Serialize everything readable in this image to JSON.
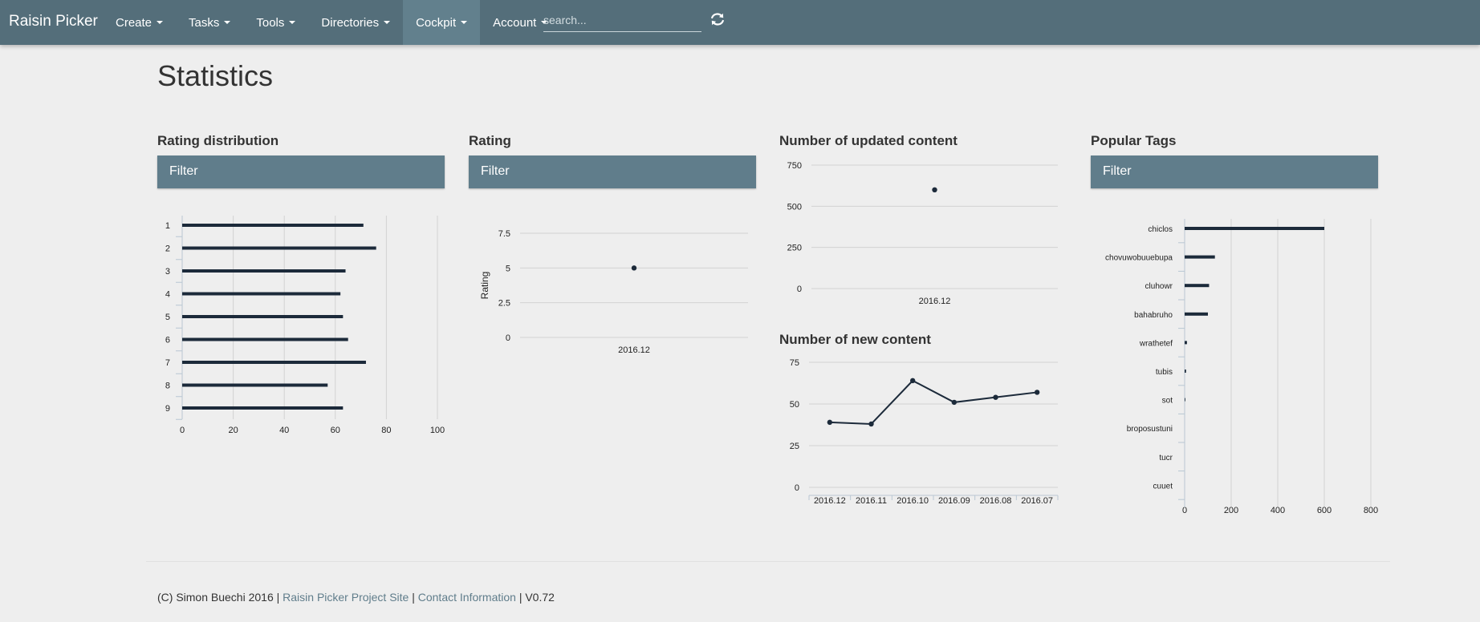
{
  "nav": {
    "brand": "Raisin Picker",
    "items": [
      {
        "label": "Create"
      },
      {
        "label": "Tasks"
      },
      {
        "label": "Tools"
      },
      {
        "label": "Directories"
      },
      {
        "label": "Cockpit"
      },
      {
        "label": "Account"
      }
    ],
    "active_item": "Cockpit",
    "search_placeholder": "search..."
  },
  "page": {
    "title": "Statistics"
  },
  "sections": {
    "rating_distribution": {
      "title": "Rating distribution",
      "filter_label": "Filter"
    },
    "rating": {
      "title": "Rating",
      "filter_label": "Filter"
    },
    "updated_content": {
      "title": "Number of updated content"
    },
    "new_content": {
      "title": "Number of new content"
    },
    "popular_tags": {
      "title": "Popular Tags",
      "filter_label": "Filter"
    }
  },
  "chart_data": [
    {
      "id": "rating_distribution",
      "type": "bar",
      "orientation": "horizontal",
      "categories": [
        "1",
        "2",
        "3",
        "4",
        "5",
        "6",
        "7",
        "8",
        "9"
      ],
      "values": [
        71,
        76,
        64,
        62,
        63,
        65,
        72,
        57,
        63
      ],
      "xlim": [
        0,
        100
      ],
      "xticks": [
        "0",
        "20",
        "40",
        "60",
        "80",
        "100"
      ],
      "grid": true,
      "color": "#1c2a3a"
    },
    {
      "id": "rating",
      "type": "scatter",
      "x": [
        "2016.12"
      ],
      "values": [
        5
      ],
      "ylabel": "Rating",
      "ylim": [
        0,
        7.5
      ],
      "yticks": [
        "0",
        "2.5",
        "5",
        "7.5"
      ],
      "grid": true,
      "color": "#1c2a3a"
    },
    {
      "id": "updated_content",
      "type": "scatter",
      "x": [
        "2016.12"
      ],
      "values": [
        600
      ],
      "ylim": [
        0,
        750
      ],
      "yticks": [
        "0",
        "250",
        "500",
        "750"
      ],
      "grid": true,
      "color": "#1c2a3a"
    },
    {
      "id": "new_content",
      "type": "line",
      "x": [
        "2016.12",
        "2016.11",
        "2016.10",
        "2016.09",
        "2016.08",
        "2016.07"
      ],
      "values": [
        39,
        38,
        64,
        51,
        54,
        57
      ],
      "ylim": [
        0,
        75
      ],
      "yticks": [
        "0",
        "25",
        "50",
        "75"
      ],
      "grid": true,
      "color": "#1c2a3a"
    },
    {
      "id": "popular_tags",
      "type": "bar",
      "orientation": "horizontal",
      "categories": [
        "chiclos",
        "chovuwobuuebupa",
        "cluhowr",
        "bahabruho",
        "wrathetef",
        "tubis",
        "sot",
        "broposustuni",
        "tucr",
        "cuuet"
      ],
      "values": [
        600,
        130,
        105,
        100,
        10,
        6,
        3,
        0,
        0,
        0
      ],
      "xlim": [
        0,
        800
      ],
      "xticks": [
        "0",
        "200",
        "400",
        "600",
        "800"
      ],
      "grid": true,
      "color": "#1c2a3a"
    }
  ],
  "footer": {
    "copyright": "(C) Simon Buechi 2016 |",
    "project_link": "Raisin Picker Project Site",
    "sep1": "|",
    "contact_link": "Contact Information",
    "version": "| V0.72"
  },
  "colors": {
    "navbar": "#546e7a",
    "filter": "#607d8b",
    "background": "#eeeeee",
    "series": "#1c2a3a"
  }
}
